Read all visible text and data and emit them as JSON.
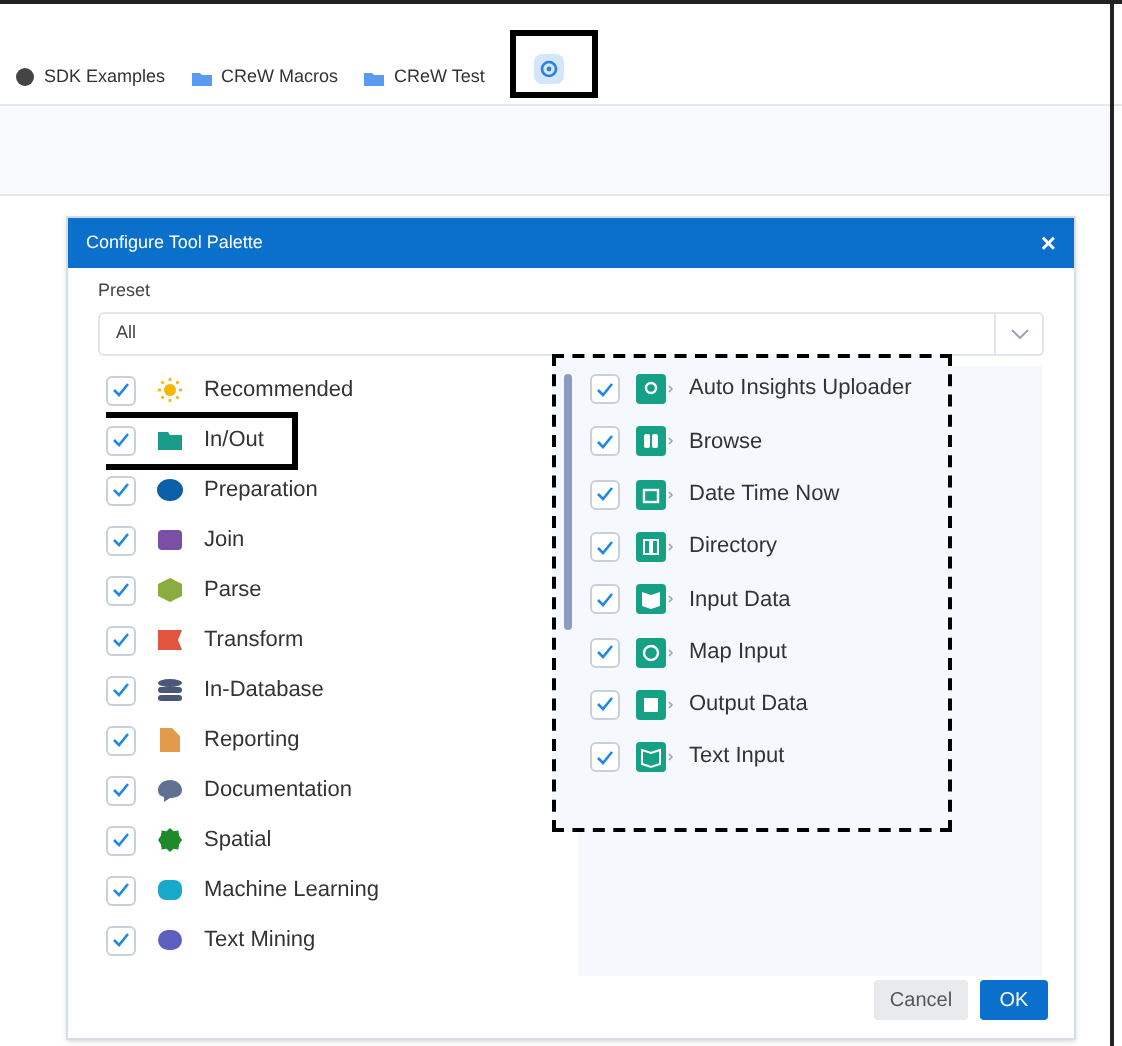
{
  "toolbar": [
    {
      "label": "SDK Examples",
      "kind": "dot",
      "highlighted": false
    },
    {
      "label": "CReW Macros",
      "kind": "folder",
      "highlighted": false
    },
    {
      "label": "CReW Test",
      "kind": "folder",
      "highlighted": false
    },
    {
      "kind": "settings",
      "highlighted": true
    }
  ],
  "dialog": {
    "title": "Configure Tool Palette",
    "close": "×",
    "preset": {
      "label": "Preset",
      "value": "All"
    },
    "categories": [
      {
        "label": "Recommended",
        "checked": true,
        "highlighted": false,
        "color": "#f5b800"
      },
      {
        "label": "In/Out",
        "checked": true,
        "highlighted": true,
        "color": "#1a9c8a"
      },
      {
        "label": "Preparation",
        "checked": true,
        "highlighted": false,
        "color": "#0b5fa8"
      },
      {
        "label": "Join",
        "checked": true,
        "highlighted": false,
        "color": "#7b4fa6"
      },
      {
        "label": "Parse",
        "checked": true,
        "highlighted": false,
        "color": "#8bad3f"
      },
      {
        "label": "Transform",
        "checked": true,
        "highlighted": false,
        "color": "#e2553f"
      },
      {
        "label": "In-Database",
        "checked": true,
        "highlighted": false,
        "color": "#4a5878"
      },
      {
        "label": "Reporting",
        "checked": true,
        "highlighted": false,
        "color": "#e39a4a"
      },
      {
        "label": "Documentation",
        "checked": true,
        "highlighted": false,
        "color": "#5f7090"
      },
      {
        "label": "Spatial",
        "checked": true,
        "highlighted": false,
        "color": "#1f8a2c"
      },
      {
        "label": "Machine Learning",
        "checked": true,
        "highlighted": false,
        "color": "#17a9c9"
      },
      {
        "label": "Text Mining",
        "checked": true,
        "highlighted": false,
        "color": "#5a5fc0"
      }
    ],
    "tools_selected": true,
    "tools": [
      {
        "label": "Auto Insights Uploader",
        "checked": true
      },
      {
        "label": "Browse",
        "checked": true
      },
      {
        "label": "Date Time Now",
        "checked": true
      },
      {
        "label": "Directory",
        "checked": true
      },
      {
        "label": "Input Data",
        "checked": true
      },
      {
        "label": "Map Input",
        "checked": true
      },
      {
        "label": "Output Data",
        "checked": true
      },
      {
        "label": "Text Input",
        "checked": true
      }
    ],
    "buttons": [
      {
        "label": "Cancel",
        "kind": "secondary"
      },
      {
        "label": "OK",
        "kind": "primary"
      }
    ]
  }
}
